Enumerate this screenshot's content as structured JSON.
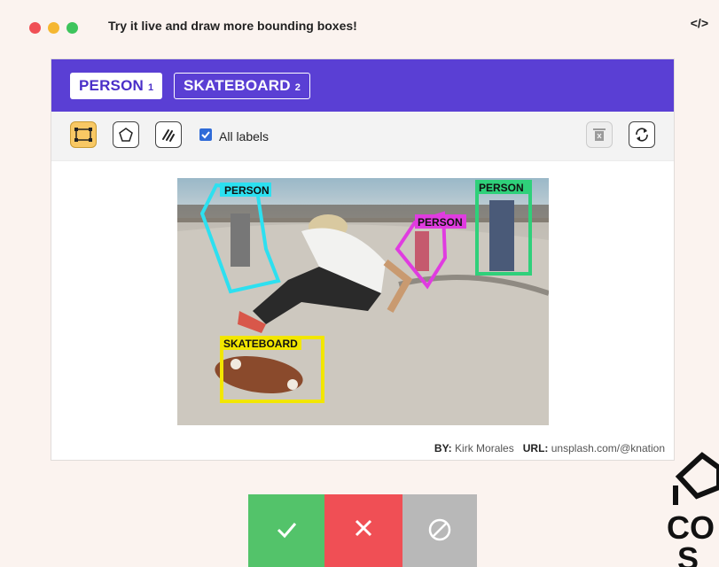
{
  "window": {
    "title": "Try it live and draw more bounding boxes!",
    "code_icon": "</>",
    "dot_colors": [
      "#f04f55",
      "#f5b731",
      "#3dc45c"
    ]
  },
  "labels": [
    {
      "name": "PERSON",
      "count": "1"
    },
    {
      "name": "SKATEBOARD",
      "count": "2"
    }
  ],
  "toolbar": {
    "all_labels": "All labels",
    "tools": [
      "bounding-box-tool",
      "polygon-tool",
      "brush-tool"
    ]
  },
  "annotations": {
    "person_1": "PERSON",
    "person_2": "PERSON",
    "person_3": "PERSON",
    "skateboard": "SKATEBOARD"
  },
  "credit": {
    "by_label": "BY:",
    "by": "Kirk Morales",
    "url_label": "URL:",
    "url": "unsplash.com/@knation"
  },
  "actions": [
    "accept",
    "reject",
    "skip"
  ],
  "colors": {
    "accent": "#5a3fd4",
    "cyan": "#2de0f0",
    "magenta": "#e03ce0",
    "green": "#2fd07a",
    "yellow": "#f2e600"
  },
  "logo": {
    "partial_text_1": "CO",
    "partial_text_2": "S"
  }
}
